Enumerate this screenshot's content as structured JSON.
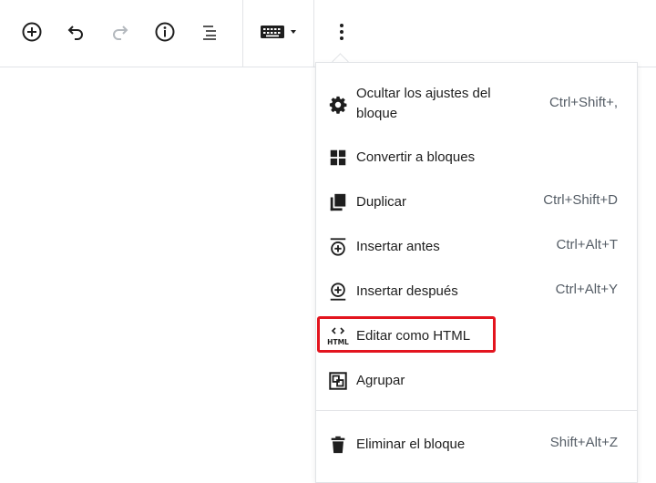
{
  "toolbar": {
    "buttons": [
      {
        "name": "add-block-icon"
      },
      {
        "name": "undo-icon"
      },
      {
        "name": "redo-icon",
        "disabled": true
      },
      {
        "name": "info-icon"
      },
      {
        "name": "block-navigation-icon"
      },
      {
        "name": "keyboard-icon"
      },
      {
        "name": "more-options-icon"
      }
    ]
  },
  "menu": {
    "items": [
      {
        "icon": "gear-icon",
        "label_line1": "Ocultar los ajustes del",
        "label_line2": "bloque",
        "shortcut": "Ctrl+Shift+,"
      },
      {
        "icon": "grid-icon",
        "label": "Convertir a bloques",
        "shortcut": ""
      },
      {
        "icon": "duplicate-icon",
        "label": "Duplicar",
        "shortcut": "Ctrl+Shift+D"
      },
      {
        "icon": "insert-before-icon",
        "label": "Insertar antes",
        "shortcut": "Ctrl+Alt+T"
      },
      {
        "icon": "insert-after-icon",
        "label": "Insertar después",
        "shortcut": "Ctrl+Alt+Y"
      },
      {
        "icon": "html-icon",
        "label": "Editar como HTML",
        "shortcut": ""
      },
      {
        "icon": "group-icon",
        "label": "Agrupar",
        "shortcut": ""
      },
      {
        "icon": "trash-icon",
        "label": "Eliminar el bloque",
        "shortcut": "Shift+Alt+Z"
      }
    ],
    "highlight_color": "#e3141e"
  }
}
